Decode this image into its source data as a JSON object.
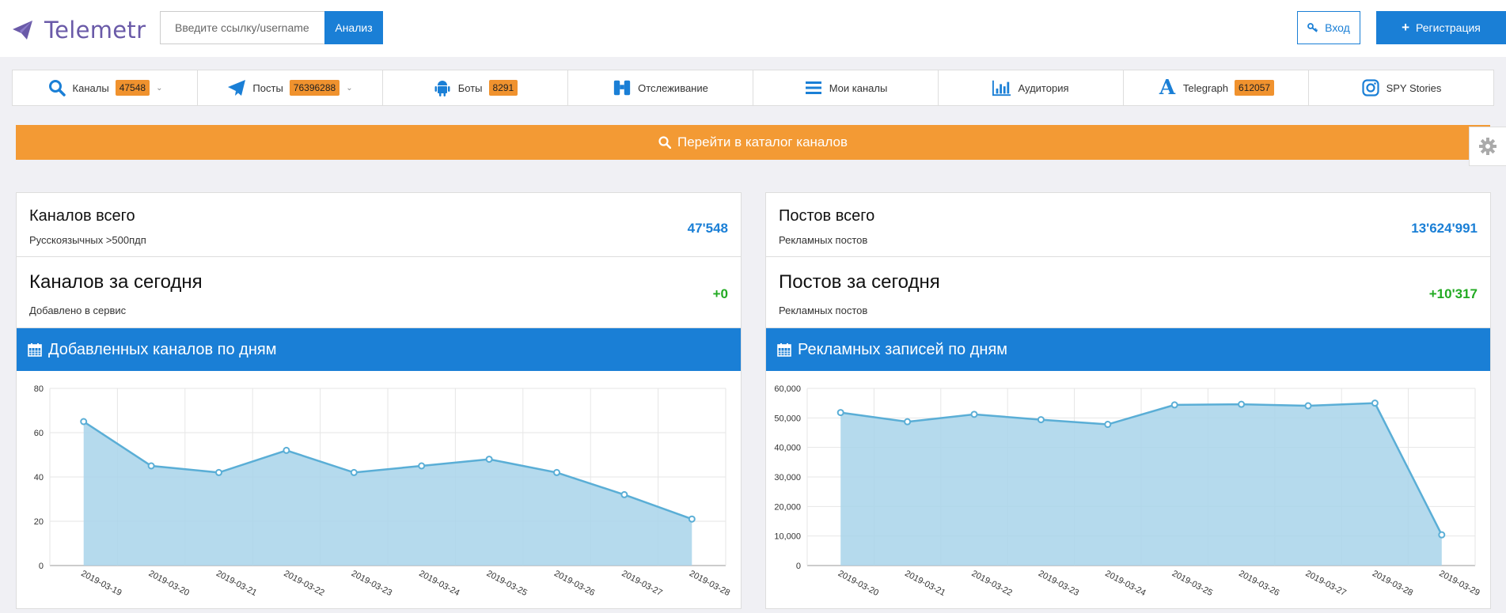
{
  "header": {
    "logo_text": "Telemetr",
    "search_placeholder": "Введите ссылку/username",
    "analyze_label": "Анализ",
    "login_label": "Вход",
    "register_label": "Регистрация"
  },
  "nav": {
    "items": [
      {
        "label": "Каналы",
        "badge": "47548",
        "icon": "search-icon"
      },
      {
        "label": "Посты",
        "badge": "76396288",
        "icon": "paper-plane-icon"
      },
      {
        "label": "Боты",
        "badge": "8291",
        "icon": "android-icon"
      },
      {
        "label": "Отслеживание",
        "badge": "",
        "icon": "binoculars-icon"
      },
      {
        "label": "Мои каналы",
        "badge": "",
        "icon": "list-icon"
      },
      {
        "label": "Аудитория",
        "badge": "",
        "icon": "bar-chart-icon"
      },
      {
        "label": "Telegraph",
        "badge": "612057",
        "icon": "letter-a-icon"
      },
      {
        "label": "SPY Stories",
        "badge": "",
        "icon": "instagram-icon"
      }
    ]
  },
  "catalog_bar": {
    "label": "Перейти в каталог каналов"
  },
  "colors": {
    "brand_blue": "#1a7fd6",
    "accent_orange": "#f39a34",
    "positive_green": "#22aa22",
    "chart_fill": "#a8d4ea",
    "chart_line": "#5aaed6"
  },
  "left_panel": {
    "stat1": {
      "title": "Каналов всего",
      "subtitle": "Русскоязычных >500пдп",
      "value": "47'548"
    },
    "stat2": {
      "title": "Каналов за сегодня",
      "subtitle": "Добавлено в сервис",
      "value": "+0"
    },
    "chart_title": "Добавленных каналов по дням"
  },
  "right_panel": {
    "stat1": {
      "title": "Постов всего",
      "subtitle": "Рекламных постов",
      "value": "13'624'991"
    },
    "stat2": {
      "title": "Постов за сегодня",
      "subtitle": "Рекламных постов",
      "value": "+10'317"
    },
    "chart_title": "Рекламных записей по дням"
  },
  "chart_data": [
    {
      "type": "area",
      "title": "Добавленных каналов по дням",
      "xlabel": "",
      "ylabel": "",
      "x": [
        "2019-03-19",
        "2019-03-20",
        "2019-03-21",
        "2019-03-22",
        "2019-03-23",
        "2019-03-24",
        "2019-03-25",
        "2019-03-26",
        "2019-03-27",
        "2019-03-28"
      ],
      "series": [
        {
          "values": [
            65,
            45,
            42,
            52,
            42,
            45,
            48,
            42,
            32,
            21
          ]
        }
      ],
      "yticks": [
        "0",
        "20",
        "40",
        "60",
        "80"
      ],
      "ylim": [
        0,
        80
      ],
      "grid": true
    },
    {
      "type": "area",
      "title": "Рекламных записей по дням",
      "xlabel": "",
      "ylabel": "",
      "x": [
        "2019-03-20",
        "2019-03-21",
        "2019-03-22",
        "2019-03-23",
        "2019-03-24",
        "2019-03-25",
        "2019-03-26",
        "2019-03-27",
        "2019-03-28",
        "2019-03-29"
      ],
      "series": [
        {
          "values": [
            51800,
            48700,
            51200,
            49400,
            47800,
            54400,
            54600,
            54100,
            55000,
            10400
          ]
        }
      ],
      "yticks": [
        "0",
        "10,000",
        "20,000",
        "30,000",
        "40,000",
        "50,000",
        "60,000"
      ],
      "ylim": [
        0,
        60000
      ],
      "grid": true
    }
  ]
}
